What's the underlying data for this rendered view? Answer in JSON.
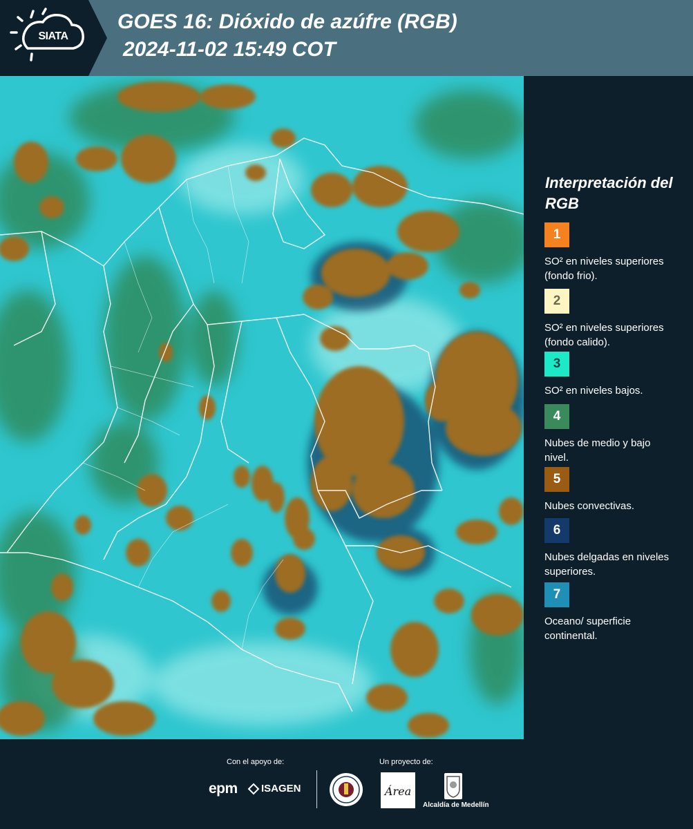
{
  "header": {
    "logo_text": "SIATA",
    "title_line1": "GOES 16: Dióxido de azúfre (RGB)",
    "title_line2": "2024-11-02 15:49 COT"
  },
  "legend": {
    "title": "Interpretación del RGB",
    "items": [
      {
        "number": "1",
        "color": "#f5821f",
        "text": "SO² en niveles superiores (fondo frio)."
      },
      {
        "number": "2",
        "color": "#fdf6c3",
        "text": "SO² en niveles superiores (fondo calido)."
      },
      {
        "number": "3",
        "color": "#1de9c6",
        "text": "SO² en niveles bajos."
      },
      {
        "number": "4",
        "color": "#3a8a5c",
        "text": "Nubes de medio y bajo nivel."
      },
      {
        "number": "5",
        "color": "#9a5b14",
        "text": "Nubes convectivas."
      },
      {
        "number": "6",
        "color": "#133a6a",
        "text": "Nubes delgadas en niveles superiores."
      },
      {
        "number": "7",
        "color": "#1f8fb5",
        "text": "Oceano/ superficie continental."
      }
    ]
  },
  "footer": {
    "support_label": "Con el apoyo de:",
    "project_label": "Un proyecto de:",
    "epm": "epm",
    "isagen": "ISAGEN",
    "area_logo": "Área",
    "alcaldia": "Alcaldía de Medellín"
  },
  "colors": {
    "header_bg": "#4a7080",
    "panel_bg": "#0e1f2c",
    "cyan_background": "#2ec9d2",
    "convective_cloud": "#9a6b22",
    "low_cloud": "#2f8a5e"
  }
}
